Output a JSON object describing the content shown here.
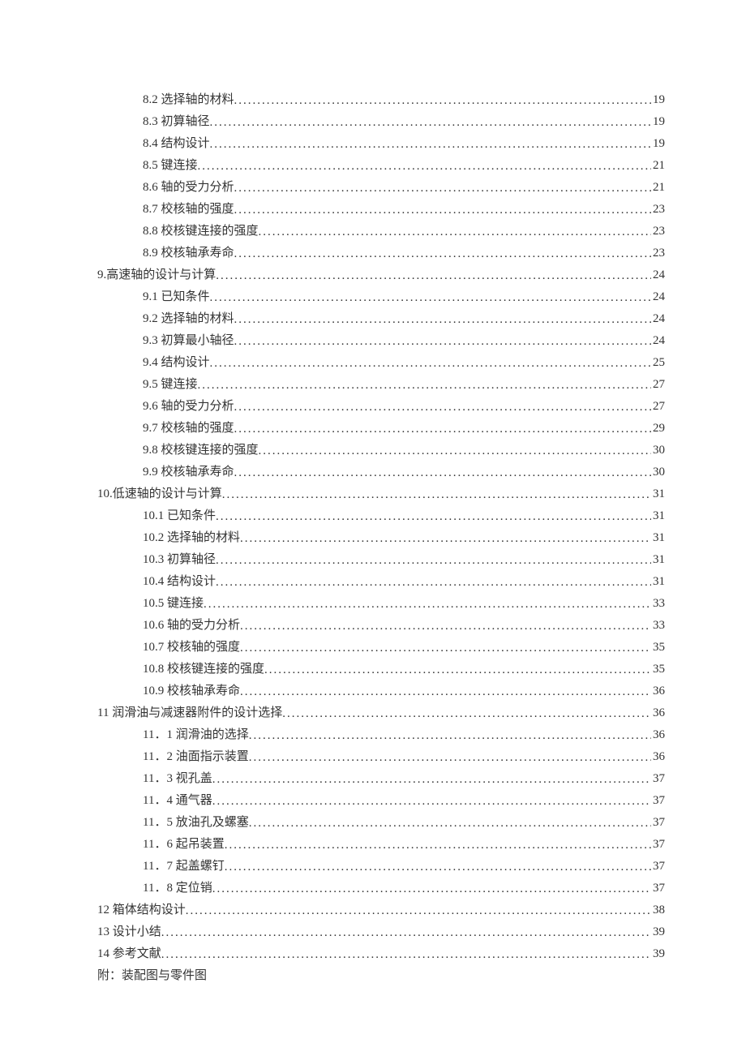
{
  "toc": {
    "entries": [
      {
        "level": 2,
        "title": "8.2 选择轴的材料",
        "page": "19"
      },
      {
        "level": 2,
        "title": "8.3 初算轴径",
        "page": "19"
      },
      {
        "level": 2,
        "title": "8.4 结构设计",
        "page": "19"
      },
      {
        "level": 2,
        "title": "8.5 键连接",
        "page": "21"
      },
      {
        "level": 2,
        "title": "8.6 轴的受力分析",
        "page": "21"
      },
      {
        "level": 2,
        "title": "8.7 校核轴的强度",
        "page": "23"
      },
      {
        "level": 2,
        "title": "8.8 校核键连接的强度",
        "page": "23"
      },
      {
        "level": 2,
        "title": "8.9 校核轴承寿命",
        "page": "23"
      },
      {
        "level": 1,
        "title": "9.高速轴的设计与计算",
        "page": "24"
      },
      {
        "level": 2,
        "title": "9.1 已知条件",
        "page": "24"
      },
      {
        "level": 2,
        "title": "9.2 选择轴的材料",
        "page": "24"
      },
      {
        "level": 2,
        "title": "9.3 初算最小轴径",
        "page": "24"
      },
      {
        "level": 2,
        "title": "9.4 结构设计",
        "page": "25"
      },
      {
        "level": 2,
        "title": "9.5 键连接",
        "page": "27"
      },
      {
        "level": 2,
        "title": "9.6 轴的受力分析",
        "page": "27"
      },
      {
        "level": 2,
        "title": "9.7 校核轴的强度",
        "page": "29"
      },
      {
        "level": 2,
        "title": "9.8 校核键连接的强度",
        "page": "30"
      },
      {
        "level": 2,
        "title": "9.9 校核轴承寿命",
        "page": "30"
      },
      {
        "level": 1,
        "title": "10.低速轴的设计与计算",
        "page": "31"
      },
      {
        "level": 2,
        "title": "10.1 已知条件",
        "page": "31"
      },
      {
        "level": 2,
        "title": "10.2 选择轴的材料",
        "page": "31"
      },
      {
        "level": 2,
        "title": "10.3 初算轴径",
        "page": "31"
      },
      {
        "level": 2,
        "title": "10.4 结构设计",
        "page": "31"
      },
      {
        "level": 2,
        "title": "10.5 键连接",
        "page": "33"
      },
      {
        "level": 2,
        "title": "10.6 轴的受力分析",
        "page": "33"
      },
      {
        "level": 2,
        "title": "10.7 校核轴的强度",
        "page": "35"
      },
      {
        "level": 2,
        "title": "10.8 校核键连接的强度",
        "page": "35"
      },
      {
        "level": 2,
        "title": "10.9 校核轴承寿命",
        "page": "36"
      },
      {
        "level": 1,
        "title": "11  润滑油与减速器附件的设计选择",
        "page": "36"
      },
      {
        "level": 2,
        "title": "11．1 润滑油的选择",
        "page": "36"
      },
      {
        "level": 2,
        "title": "11．2 油面指示装置",
        "page": "36"
      },
      {
        "level": 2,
        "title": "11．3 视孔盖",
        "page": "37"
      },
      {
        "level": 2,
        "title": "11．4 通气器",
        "page": "37"
      },
      {
        "level": 2,
        "title": "11．5 放油孔及螺塞",
        "page": "37"
      },
      {
        "level": 2,
        "title": "11．6 起吊装置",
        "page": "37"
      },
      {
        "level": 2,
        "title": "11．7 起盖螺钉",
        "page": "37"
      },
      {
        "level": 2,
        "title": "11．8 定位销",
        "page": "37"
      },
      {
        "level": 1,
        "title": "12 箱体结构设计",
        "page": "38"
      },
      {
        "level": 1,
        "title": "13 设计小结",
        "page": "39"
      },
      {
        "level": 1,
        "title": "14 参考文献",
        "page": "39"
      }
    ],
    "appendix": "附：装配图与零件图"
  }
}
